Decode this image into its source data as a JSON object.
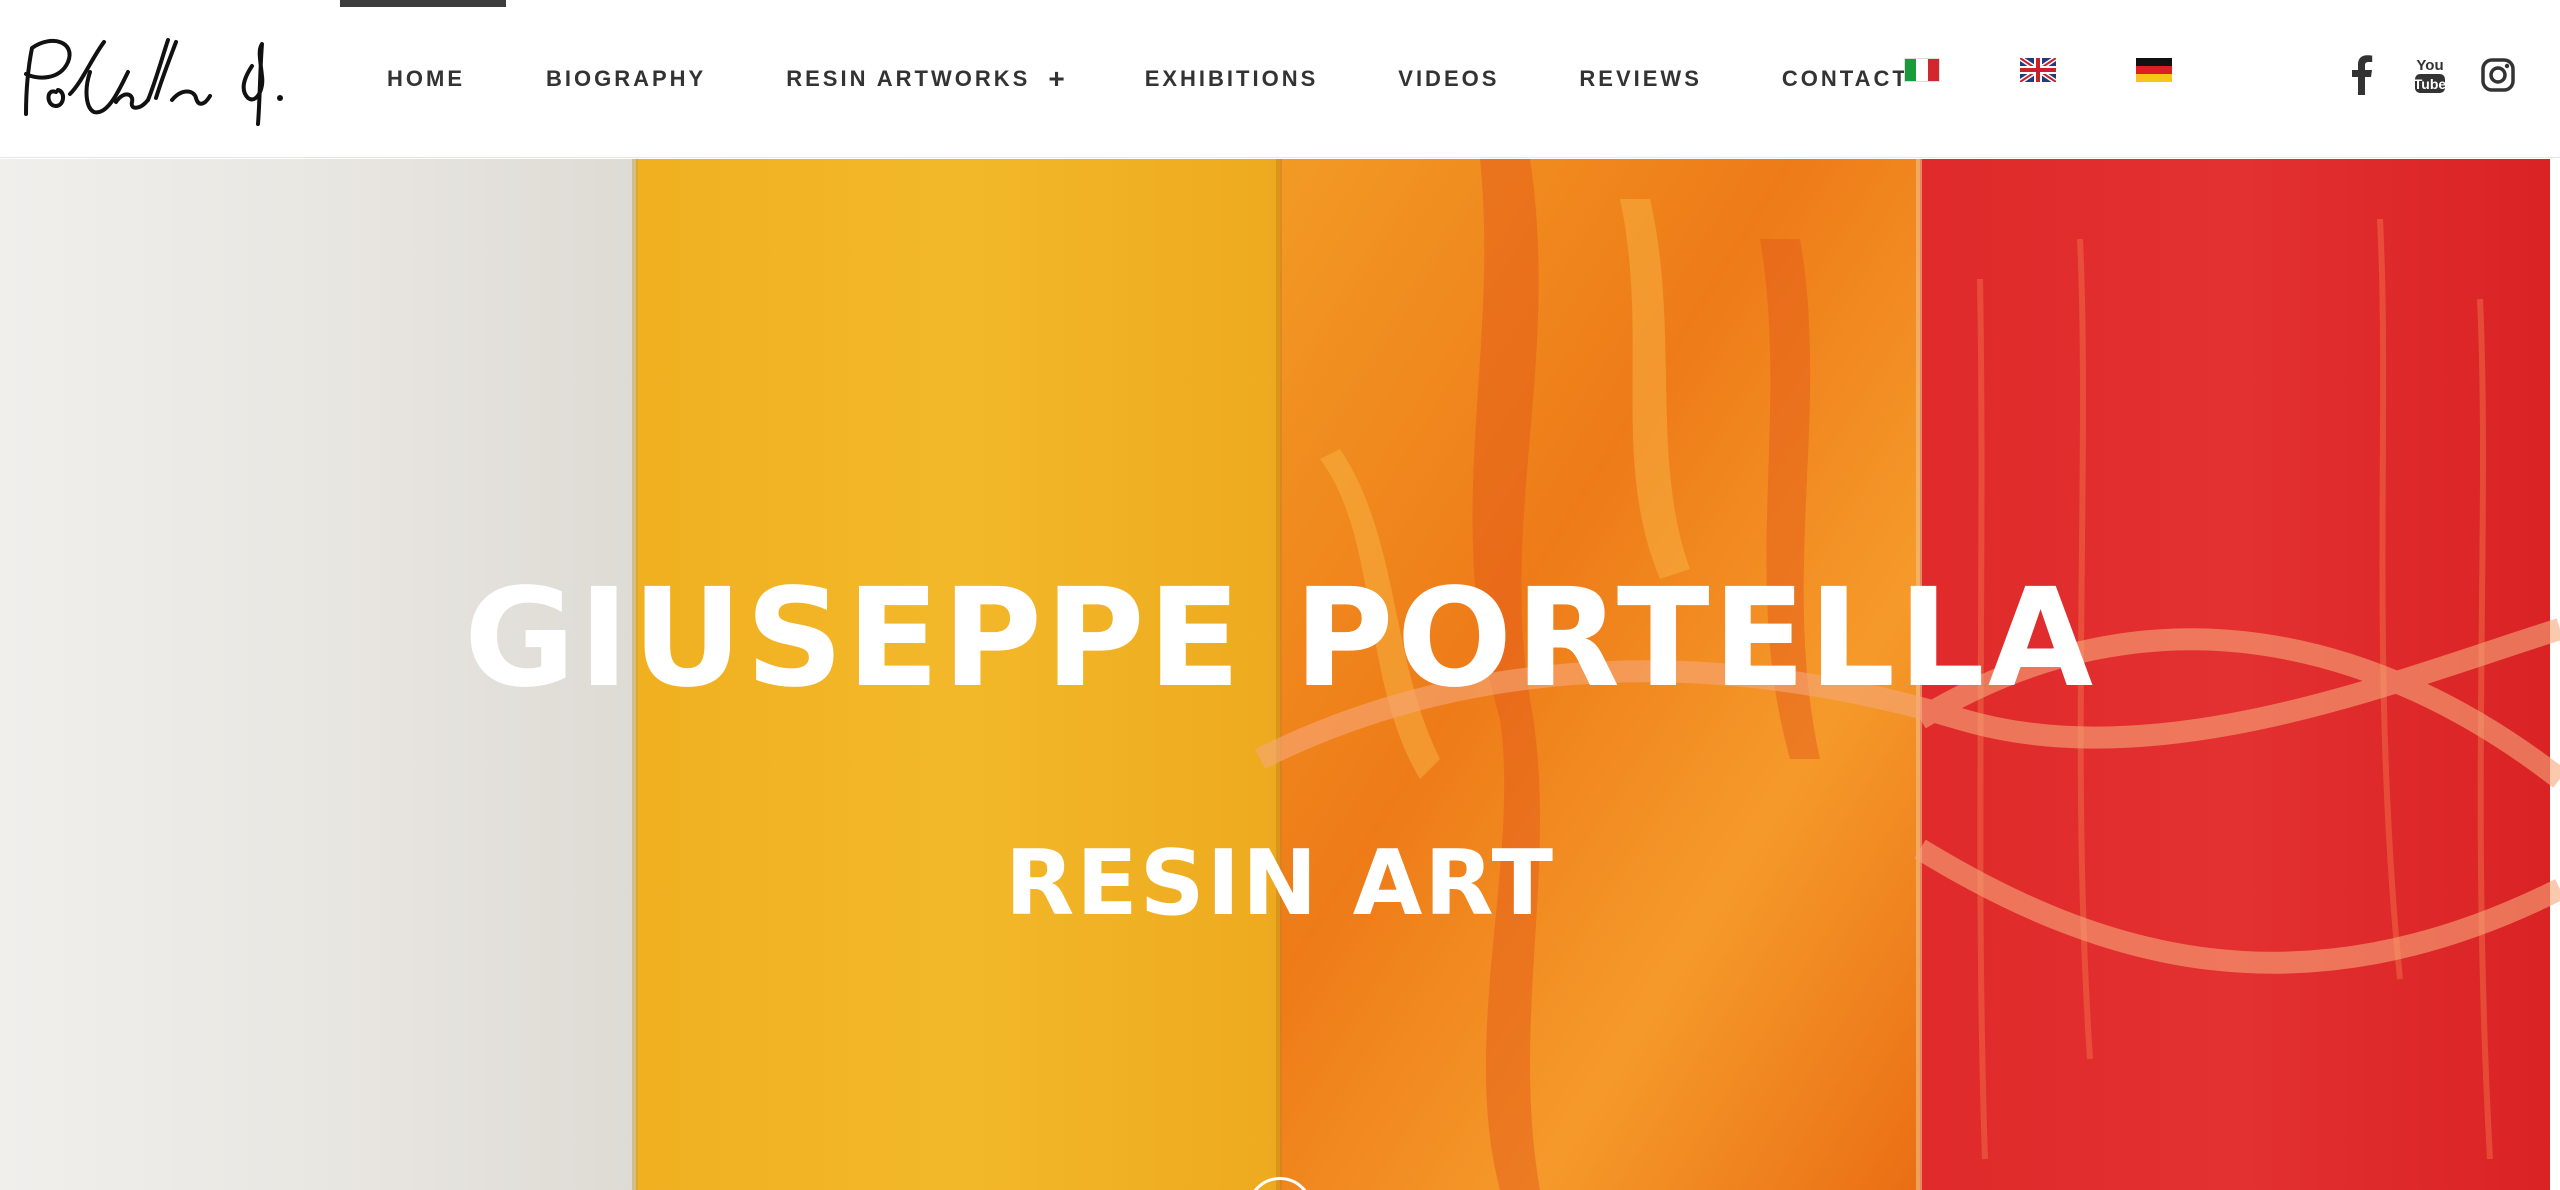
{
  "logo": {
    "alt": "Portella G. signature",
    "icon": "signature-logo"
  },
  "nav": {
    "home": "HOME",
    "biography": "BIOGRAPHY",
    "resin_artworks": "RESIN ARTWORKS",
    "resin_artworks_expand": "+",
    "exhibitions": "EXHIBITIONS",
    "videos": "VIDEOS",
    "reviews": "REVIEWS",
    "contact": "CONTACT",
    "active": "HOME"
  },
  "languages": [
    {
      "code": "it",
      "icon": "italy-flag-icon"
    },
    {
      "code": "en",
      "icon": "uk-flag-icon"
    },
    {
      "code": "de",
      "icon": "germany-flag-icon"
    }
  ],
  "social": [
    {
      "name": "facebook",
      "icon": "facebook-icon"
    },
    {
      "name": "youtube",
      "icon": "youtube-icon",
      "text_top": "You",
      "text_bottom": "Tube"
    },
    {
      "name": "instagram",
      "icon": "instagram-icon"
    }
  ],
  "hero": {
    "title": "GIUSEPPE PORTELLA",
    "subtitle": "RESIN ART",
    "panel_colors": [
      "#e8e6e2",
      "#f2b525",
      "#f08a1c",
      "#e1272a"
    ]
  }
}
